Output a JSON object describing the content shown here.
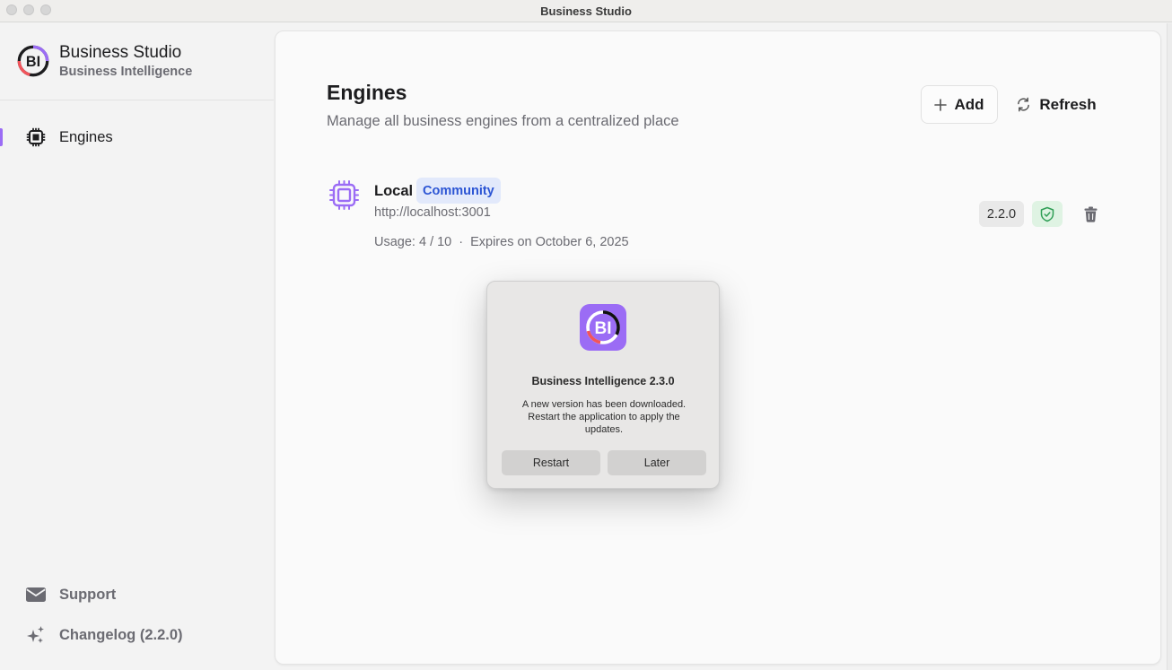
{
  "window": {
    "title": "Business Studio"
  },
  "sidebar": {
    "brand": {
      "name": "Business Studio",
      "subtitle": "Business Intelligence",
      "logo_text": "BI"
    },
    "items": [
      {
        "label": "Engines",
        "icon": "cpu-chip-icon",
        "active": true
      },
      {
        "label": "Support",
        "icon": "envelope-icon",
        "active": false
      },
      {
        "label": "Changelog (2.2.0)",
        "icon": "sparkles-icon",
        "active": false
      }
    ],
    "accent_color": "#9b6cf5"
  },
  "main": {
    "title": "Engines",
    "subtitle": "Manage all business engines from a centralized place",
    "actions": {
      "add_label": "Add",
      "refresh_label": "Refresh"
    },
    "engines": [
      {
        "name": "Local",
        "tier_badge": "Community",
        "url": "http://localhost:3001",
        "usage_label": "Usage: 4 / 10",
        "usage_used": 4,
        "usage_total": 10,
        "separator": "·",
        "expires": "Expires on October 6, 2025",
        "version": "2.2.0",
        "status_icon": "shield-check-icon",
        "status_color": "#2f9e55"
      }
    ]
  },
  "dialog": {
    "icon_text": "BI",
    "title": "Business Intelligence 2.3.0",
    "message": "A new version has been downloaded. Restart the application to apply the updates.",
    "restart_label": "Restart",
    "later_label": "Later"
  }
}
